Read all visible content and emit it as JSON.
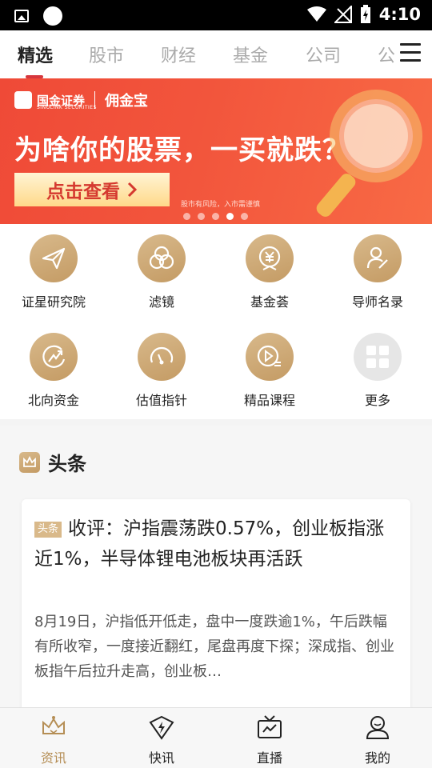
{
  "status_bar": {
    "time": "4:10"
  },
  "tabs": [
    {
      "label": "精选",
      "active": true
    },
    {
      "label": "股市"
    },
    {
      "label": "财经"
    },
    {
      "label": "基金"
    },
    {
      "label": "公司"
    },
    {
      "label": "公"
    }
  ],
  "banner": {
    "brand": "国金证券",
    "brand_en": "SINOLINK SECURITIES",
    "product": "佣金宝",
    "headline": "为啥你的股票，一买就跌？",
    "button_label": "点击查看",
    "note": "股市有风险，入市需谨慎",
    "page_count": 5,
    "active_page": 4
  },
  "shortcuts": [
    {
      "label": "证星研究院",
      "icon": "paper-plane-icon"
    },
    {
      "label": "滤镜",
      "icon": "filter-circles-icon"
    },
    {
      "label": "基金荟",
      "icon": "fund-yuan-icon"
    },
    {
      "label": "导师名录",
      "icon": "mentor-icon"
    },
    {
      "label": "北向资金",
      "icon": "north-capital-icon"
    },
    {
      "label": "估值指针",
      "icon": "gauge-icon"
    },
    {
      "label": "精品课程",
      "icon": "play-course-icon"
    },
    {
      "label": "更多",
      "icon": "grid-more-icon"
    }
  ],
  "headlines": {
    "title": "头条",
    "card": {
      "tag": "头条",
      "title": "收评：沪指震荡跌0.57%，创业板指涨近1%，半导体锂电池板块再活跃",
      "summary": "8月19日，沪指低开低走，盘中一度跌逾1%，午后跌幅有所收窄，一度接近翻红，尾盘再度下探；深成指、创业板指午后拉升走高，创业板…"
    }
  },
  "bottom_nav": [
    {
      "label": "资讯",
      "icon": "crown-icon",
      "active": true
    },
    {
      "label": "快讯",
      "icon": "lightning-badge-icon"
    },
    {
      "label": "直播",
      "icon": "tv-icon"
    },
    {
      "label": "我的",
      "icon": "user-icon"
    }
  ],
  "colors": {
    "accent": "#d6373d",
    "gold": "#c49b64",
    "banner": "#f2553c"
  }
}
